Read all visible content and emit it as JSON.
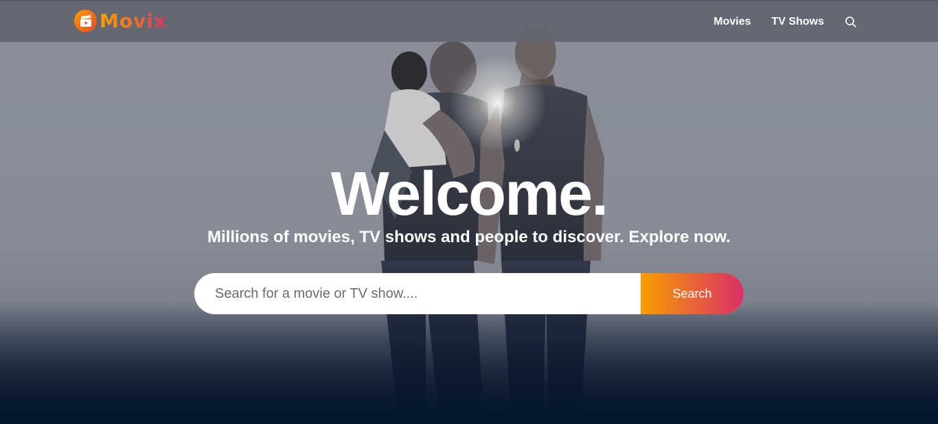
{
  "app": {
    "logo_text": "Movix"
  },
  "header": {
    "nav": [
      {
        "label": "Movies"
      },
      {
        "label": "TV Shows"
      }
    ],
    "search_icon": "search-icon"
  },
  "hero": {
    "background_image": "two-men-standing-poster",
    "title": "Welcome.",
    "subtitle": "Millions of movies, TV shows and people to discover. Explore now.",
    "search": {
      "placeholder": "Search for a movie or TV show....",
      "value": "",
      "button_label": "Search"
    }
  },
  "colors": {
    "accent_start": "#f89e00",
    "accent_end": "#da2f68",
    "background_dark": "#04152d"
  }
}
